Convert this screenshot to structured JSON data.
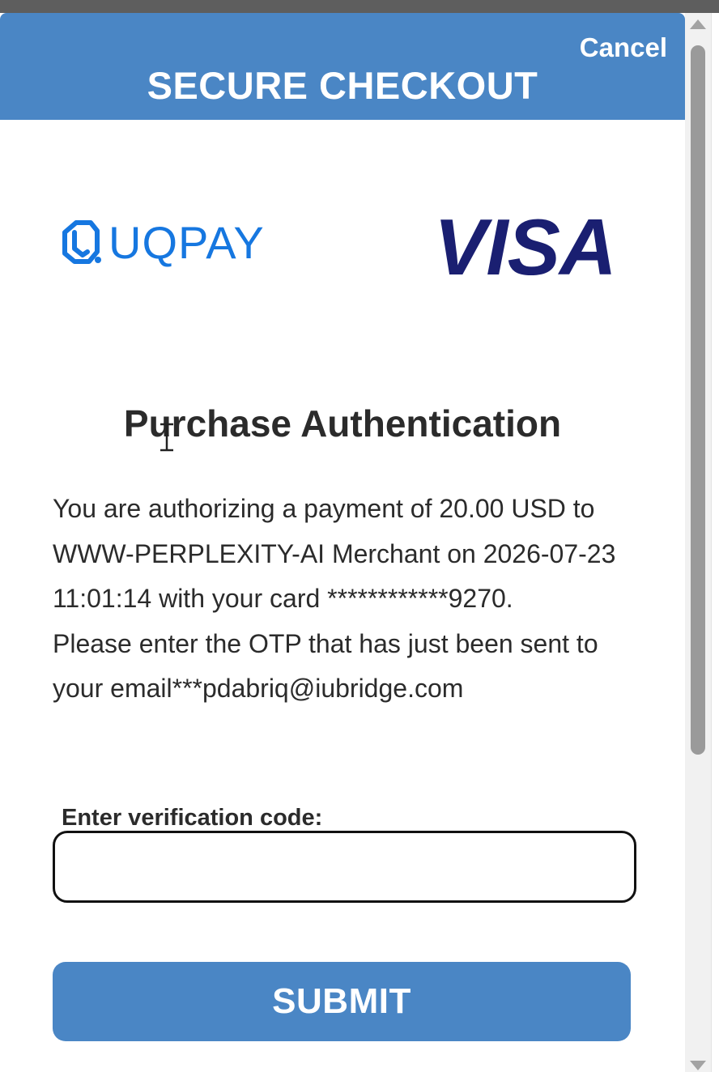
{
  "header": {
    "cancel_label": "Cancel",
    "title": "SECURE CHECKOUT",
    "background_color": "#4a86c5"
  },
  "logos": {
    "left_icon": "uqpay-logo-icon",
    "left_brand": "UQPAY",
    "right_brand": "VISA",
    "uqpay_color": "#1677e0",
    "visa_color": "#1a1f71"
  },
  "main": {
    "title": "Purchase Authentication",
    "message_line1": "You are authorizing a payment of 20.00 USD to WWW-PERPLEXITY-AI Merchant on 2026-07-23 11:01:14 with your card ************9270.",
    "message_line2": "Please enter the OTP that has just been sent to your email***pdabriq@iubridge.com"
  },
  "form": {
    "code_label": "Enter verification code:",
    "code_value": "",
    "code_placeholder": "",
    "submit_label": "SUBMIT"
  },
  "scrollbar": {
    "up_icon": "arrow-up-icon",
    "down_icon": "arrow-down-icon"
  }
}
